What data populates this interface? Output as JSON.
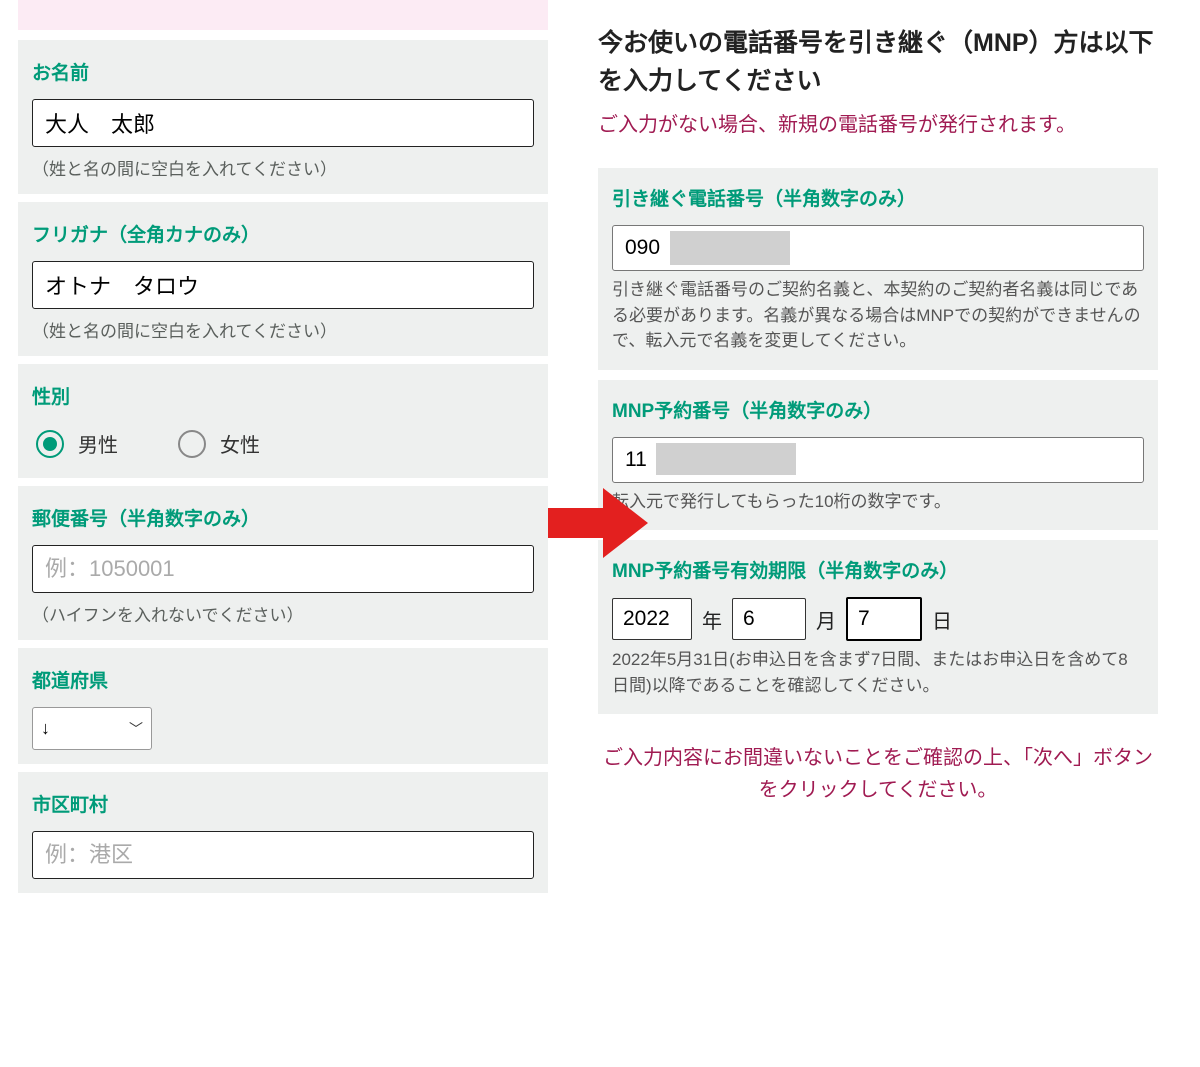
{
  "left": {
    "name": {
      "label": "お名前",
      "value": "大人　太郎",
      "helper": "（姓と名の間に空白を入れてください）"
    },
    "furigana": {
      "label": "フリガナ（全角カナのみ）",
      "value": "オトナ　タロウ",
      "helper": "（姓と名の間に空白を入れてください）"
    },
    "gender": {
      "label": "性別",
      "male": "男性",
      "female": "女性"
    },
    "postal": {
      "label": "郵便番号（半角数字のみ）",
      "placeholder": "例：1050001",
      "helper": "（ハイフンを入れないでください）"
    },
    "prefecture": {
      "label": "都道府県",
      "selected": "↓"
    },
    "city": {
      "label": "市区町村",
      "placeholder": "例：港区"
    }
  },
  "right": {
    "title": "今お使いの電話番号を引き継ぐ（MNP）方は以下を入力してください",
    "warn": "ご入力がない場合、新規の電話番号が発行されます。",
    "phone": {
      "label": "引き継ぐ電話番号（半角数字のみ）",
      "value": "090",
      "helper": "引き継ぐ電話番号のご契約名義と、本契約のご契約者名義は同じである必要があります。名義が異なる場合はMNPでの契約ができませんので、転入元で名義を変更してください。"
    },
    "mnp_num": {
      "label": "MNP予約番号（半角数字のみ）",
      "value": "11",
      "helper": "転入元で発行してもらった10桁の数字です。"
    },
    "mnp_expiry": {
      "label": "MNP予約番号有効期限（半角数字のみ）",
      "year": "2022",
      "year_label": "年",
      "month": "6",
      "month_label": "月",
      "day": "7",
      "day_label": "日",
      "helper": "2022年5月31日(お申込日を含まず7日間、またはお申込日を含めて8日間)以降であることを確認してください。"
    },
    "confirm": "ご入力内容にお間違いないことをご確認の上、「次へ」ボタンをクリックしてください。"
  }
}
